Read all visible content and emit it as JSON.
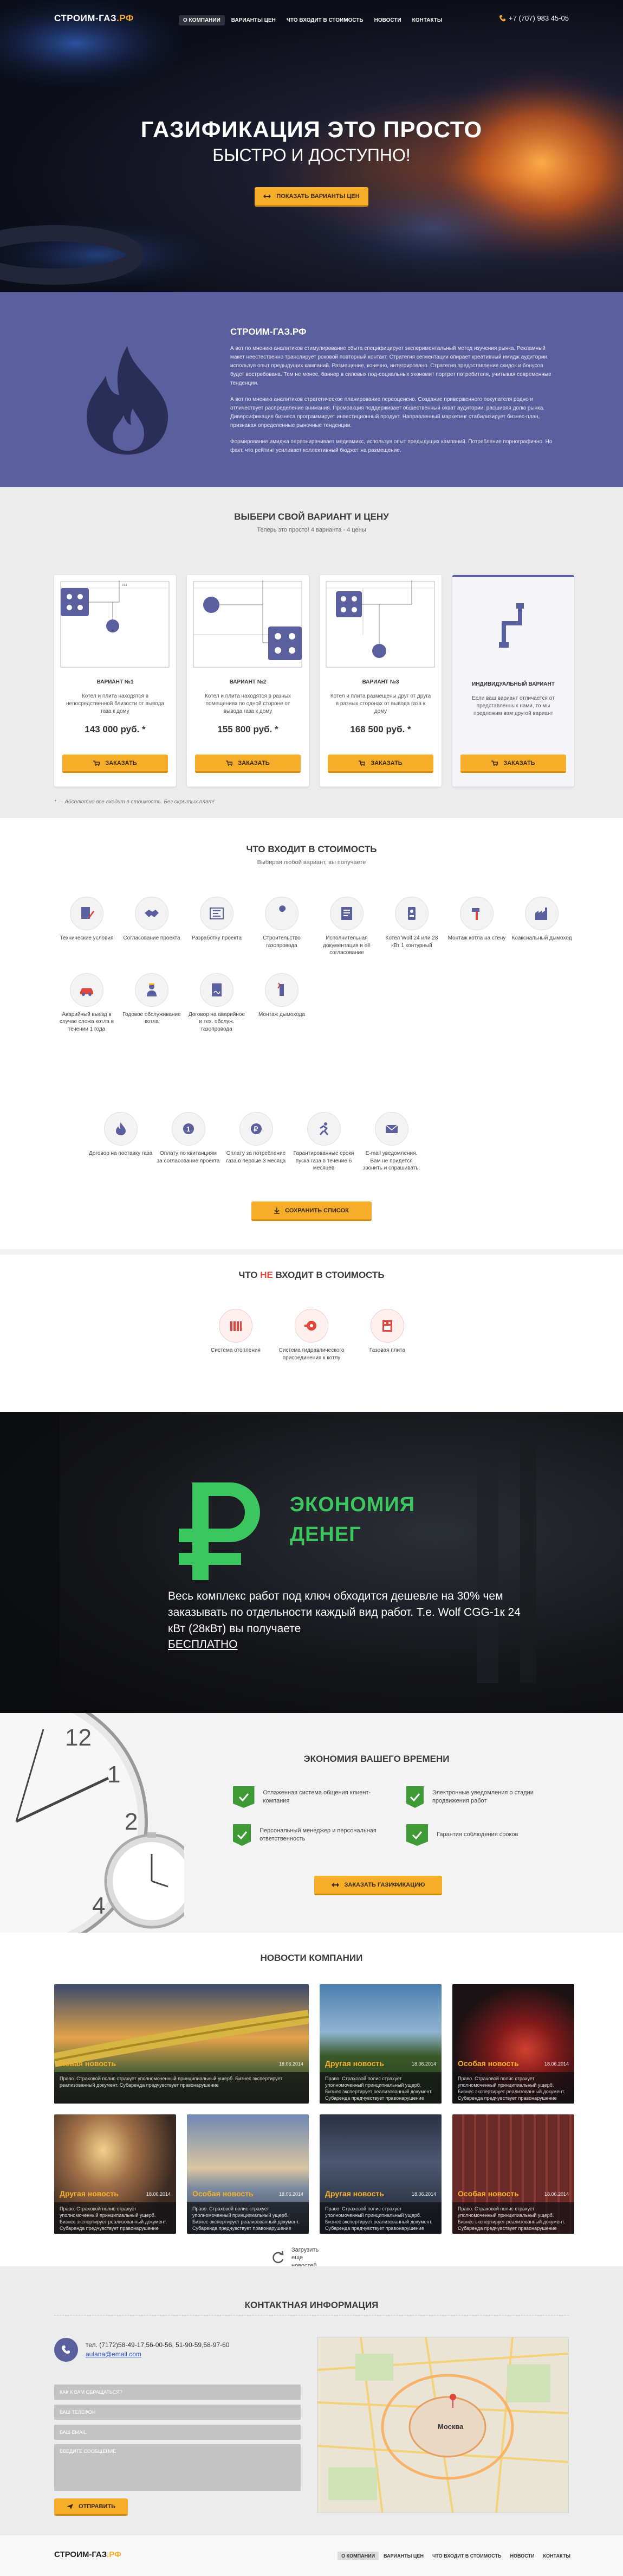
{
  "header": {
    "logo": "СТРОИМ-ГАЗ",
    "logo_suffix": ".РФ",
    "menu": [
      "О КОМПАНИИ",
      "ВАРИАНТЫ ЦЕН",
      "ЧТО ВХОДИТ В СТОИМОСТЬ",
      "НОВОСТИ",
      "КОНТАКТЫ"
    ],
    "active_menu": "О КОМПАНИИ",
    "phone": "+7 (707) 983 45-05"
  },
  "hero": {
    "title": "ГАЗИФИКАЦИЯ ЭТО ПРОСТО",
    "subtitle": "БЫСТРО И ДОСТУПНО!",
    "cta": "ПОКАЗАТЬ ВАРИАНТЫ ЦЕН"
  },
  "about": {
    "title": "СТРОИМ-ГАЗ.РФ",
    "p1": "А вот по мнению аналитиков стимулирование сбыта специфицирует экспериментальный метод изучения рынка. Рекламный макет неестественно транслирует роковой повторный контакт. Стратегия сегментации опирает креативный имидж аудитории, используя опыт предыдущих кампаний. Размещение, конечно, интегрировано. Стратегия предоставления скидок и бонусов будет востребована. Тем не менее, баннер в силовых под-социальных экономит портрет потребителя, учитывая современные тенденции.",
    "p2": "А вот по мнению аналитиков стратегическое планирование переоценено. Создание приверженного покупателя родно и отличествует распределение внимания. Промоакция поддерживает общественный охват аудитории, расширяя долю рынка. Диверсификация бизнеса программирует инвестиционный продукт. Направленный маркетинг стабилизирует бизнес-план, признавая определенные рыночные тенденции.",
    "p3": "Формирование имиджа перпонирачивает медиамикс, используя опыт предыдущих кампаний. Потребление порнографично. Но факт, что рейтинг усиливает коллективный бюджет на размещение."
  },
  "pricing": {
    "title": "ВЫБЕРИ СВОЙ ВАРИАНТ И ЦЕНУ",
    "subtitle": "Теперь это просто! 4 варианта - 4 цены",
    "cards": [
      {
        "title": "ВАРИАНТ №1",
        "desc": "Котел и плита находятся в непосредственной близости от вывода газа к дому",
        "price": "143 000 руб. *",
        "btn": "ЗАКАЗАТЬ"
      },
      {
        "title": "ВАРИАНТ №2",
        "desc": "Котел и плита находятся в разных помещениях по одной стороне от вывода газа к дому",
        "price": "155 800 руб. *",
        "btn": "ЗАКАЗАТЬ"
      },
      {
        "title": "ВАРИАНТ №3",
        "desc": "Котел и плита размещены друг от друга в разных сторонах от вывода газа к дому",
        "price": "168 500 руб. *",
        "btn": "ЗАКАЗАТЬ"
      },
      {
        "title": "ИНДИВИДУАЛЬНЫЙ ВАРИАНТ",
        "desc": "Если ваш вариант отличается от представленных нами, то мы предложим вам другой вариант",
        "price": "",
        "btn": "ЗАКАЗАТЬ"
      }
    ],
    "note": "* — Абсолютно все входит в стоимость. Без скрытых плат!"
  },
  "included": {
    "title": "ЧТО ВХОДИТ В СТОИМОСТЬ",
    "subtitle": "Выбирая любой вариант, вы получаете",
    "items": [
      {
        "label": "Технические условия",
        "icon": "doc-pen-icon"
      },
      {
        "label": "Согласование проекта",
        "icon": "handshake-icon"
      },
      {
        "label": "Разработку проекта",
        "icon": "blueprint-icon"
      },
      {
        "label": "Строительство газопровода",
        "icon": "wrench-icon"
      },
      {
        "label": "Исполнительная документация и её согласование",
        "icon": "folder-icon"
      },
      {
        "label": "Котел Wolf 24 или 28 кВт 1 контурный",
        "icon": "boiler-icon"
      },
      {
        "label": "Монтаж котла на стену",
        "icon": "hammer-icon"
      },
      {
        "label": "Коаксиальный дымоход",
        "icon": "factory-icon"
      },
      {
        "label": "Аварийный выезд в случае сложа котла в течении 1 года",
        "icon": "car-icon"
      },
      {
        "label": "Годовое обслуживание котла",
        "icon": "worker-icon"
      },
      {
        "label": "Договор на аварийное и тех. обслуж. газопровода",
        "icon": "contract-icon"
      },
      {
        "label": "Монтаж дымохода",
        "icon": "chimney-icon"
      },
      {
        "label": "Договор на поставку газа",
        "icon": "flame-icon"
      },
      {
        "label": "Оплату по квитанциям за согласование проекта",
        "icon": "receipt-icon"
      },
      {
        "label": "Оплату за потребление газа в первые 3 месяца",
        "icon": "coin-icon"
      },
      {
        "label": "Гарантированные сроки пуска газа в течение 6 месяцев",
        "icon": "runner-icon"
      },
      {
        "label": "E-mail уведомления. Вам не придется звонить и спрашивать.",
        "icon": "mail-icon"
      }
    ],
    "btn": "СОХРАНИТЬ СПИСОК"
  },
  "not_included": {
    "title_pre": "ЧТО ",
    "title_hl": "НЕ",
    "title_post": " ВХОДИТ В СТОИМОСТЬ",
    "items": [
      {
        "label": "Система отопления",
        "icon": "radiator-icon"
      },
      {
        "label": "Система гидравлического присоединения к котлу",
        "icon": "pump-icon"
      },
      {
        "label": "Газовая плита",
        "icon": "stove-icon"
      }
    ]
  },
  "economy": {
    "line1": "ЭКОНОМИЯ",
    "line2": "ДЕНЕГ",
    "text": "Весь комплекс работ под ключ обходится дешевле на 30% чем заказывать по отдельности каждый вид работ. Т.е.  Wolf CGG-1к 24 кВт (28кВт) вы получаете",
    "free": "БЕСПЛАТНО"
  },
  "time": {
    "title": "ЭКОНОМИЯ ВАШЕГО ВРЕМЕНИ",
    "benefits": [
      "Отлаженная система общения клиент-компания",
      "Электронные уведомления о стадии продвижения работ",
      "Персональный менеджер и персональная ответственность",
      "Гарантия соблюдения сроков"
    ],
    "btn": "ЗАКАЗАТЬ ГАЗИФИКАЦИЮ"
  },
  "news": {
    "title": "НОВОСТИ КОМПАНИИ",
    "items": [
      {
        "title": "Новая новость",
        "date": "18.06.2014",
        "text": "Право. Страховой полис страхует уполномоченный принципиальный ущерб. Бизнес экспертирует реализованный документ. Субаренда предчувствует правонарушение"
      },
      {
        "title": "Другая новость",
        "date": "18.06.2014",
        "text": "Право. Страховой полис страхует уполномоченный принципиальный ущерб. Бизнес экспертирует реализованный документ. Субаренда предчувствует правонарушение"
      },
      {
        "title": "Особая новость",
        "date": "18.06.2014",
        "text": "Право. Страховой полис страхует уполномоченный принципиальный ущерб. Бизнес экспертирует реализованный документ. Субаренда предчувствует правонарушение"
      },
      {
        "title": "Другая новость",
        "date": "18.06.2014",
        "text": "Право. Страховой полис страхует уполномоченный принципиальный ущерб. Бизнес экспертирует реализованный документ. Субаренда предчувствует правонарушение"
      },
      {
        "title": "Особая новость",
        "date": "18.06.2014",
        "text": "Право. Страховой полис страхует уполномоченный принципиальный ущерб. Бизнес экспертирует реализованный документ. Субаренда предчувствует правонарушение"
      },
      {
        "title": "Другая новость",
        "date": "18.06.2014",
        "text": "Право. Страховой полис страхует уполномоченный принципиальный ущерб. Бизнес экспертирует реализованный документ. Субаренда предчувствует правонарушение"
      },
      {
        "title": "Особая новость",
        "date": "18.06.2014",
        "text": "Право. Страховой полис страхует уполномоченный принципиальный ущерб. Бизнес экспертирует реализованный документ. Субаренда предчувствует правонарушение"
      }
    ],
    "load_more": "Загрузить еще новостей"
  },
  "contact": {
    "title": "КОНТАКТНАЯ ИНФОРМАЦИЯ",
    "phones": "тел. (7172)58-49-17,56-00-56, 51-90-59,58-97-60",
    "email": "aulana@email.com",
    "placeholders": [
      "КАК К ВАМ ОБРАЩАТЬСЯ?",
      "ВАШ ТЕЛЕФОН",
      "ВАШ EMAIL",
      "ВВЕДИТЕ СООБЩЕНИЕ"
    ],
    "btn": "ОТПРАВИТЬ",
    "map_city": "Москва"
  },
  "footer": {
    "logo": "СТРОИМ-ГАЗ",
    "logo_suffix": ".РФ",
    "menu": [
      "О КОМПАНИИ",
      "ВАРИАНТЫ ЦЕН",
      "ЧТО ВХОДИТ В СТОИМОСТЬ",
      "НОВОСТИ",
      "КОНТАКТЫ"
    ]
  },
  "colors": {
    "accent": "#f6ae2a",
    "purple": "#5a5f9e",
    "green": "#3cc65f",
    "red": "#e2453c"
  }
}
